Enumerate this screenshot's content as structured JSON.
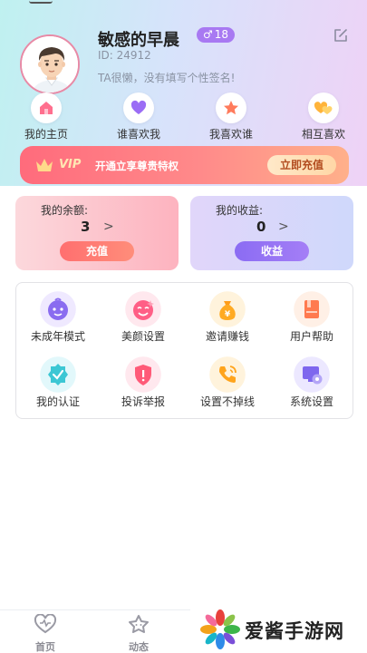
{
  "profile": {
    "username": "敏感的早晨",
    "gender_symbol": "♂",
    "age": "18",
    "id_text": "ID: 24912",
    "signature": "TA很懒，没有填写个性签名!"
  },
  "quick_nav": [
    {
      "label": "我的主页",
      "icon": "home-icon"
    },
    {
      "label": "谁喜欢我",
      "icon": "heart-icon"
    },
    {
      "label": "我喜欢谁",
      "icon": "star-icon"
    },
    {
      "label": "相互喜欢",
      "icon": "double-heart-icon"
    }
  ],
  "vip": {
    "badge": "VIP",
    "description": "开通立享尊贵特权",
    "button": "立即充值"
  },
  "wallet": {
    "balance_title": "我的余额:",
    "balance_value": "3",
    "balance_button": "充值",
    "income_title": "我的收益:",
    "income_value": "0",
    "income_button": "收益",
    "arrow": ">"
  },
  "grid": [
    {
      "label": "未成年模式",
      "icon": "child-face-icon"
    },
    {
      "label": "美颜设置",
      "icon": "beauty-face-icon"
    },
    {
      "label": "邀请赚钱",
      "icon": "money-bag-icon"
    },
    {
      "label": "用户帮助",
      "icon": "help-book-icon"
    },
    {
      "label": "我的认证",
      "icon": "verified-badge-icon"
    },
    {
      "label": "投诉举报",
      "icon": "report-shield-icon"
    },
    {
      "label": "设置不掉线",
      "icon": "phone-call-icon"
    },
    {
      "label": "系统设置",
      "icon": "system-settings-icon"
    }
  ],
  "tabs": [
    {
      "label": "首页",
      "icon": "home-heart-icon"
    },
    {
      "label": "动态",
      "icon": "moments-icon"
    }
  ],
  "watermark": {
    "text": "爱酱手游网"
  },
  "colors": {
    "accent_purple": "#a879f2",
    "vip_red": "#ff6b7c",
    "recharge_button": "#ff7373",
    "income_button": "#9573f4"
  }
}
